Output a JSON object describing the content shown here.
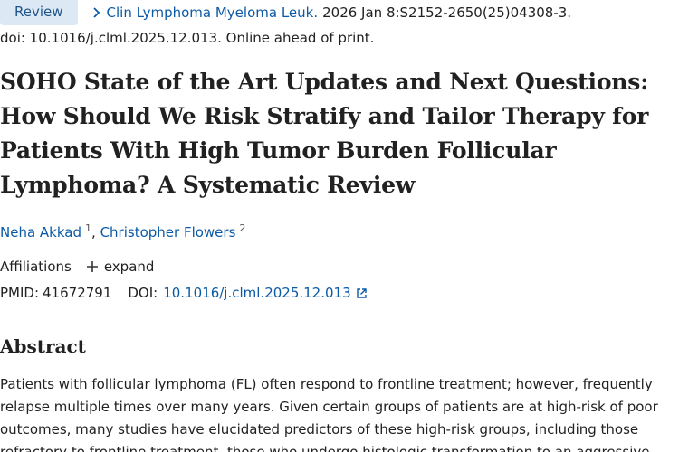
{
  "header": {
    "badge": "Review",
    "journal": "Clin Lymphoma Myeloma Leuk.",
    "citation": "2026 Jan 8:S2152-2650(25)04308-3.",
    "doi_line": "doi: 10.1016/j.clml.2025.12.013. Online ahead of print."
  },
  "article": {
    "title": "SOHO State of the Art Updates and Next Questions: How Should We Risk Stratify and Tailor Therapy for Patients With High Tumor Burden Follicular Lymphoma? A Systematic Review",
    "authors": [
      {
        "name": "Neha Akkad",
        "sup": "1"
      },
      {
        "name": "Christopher Flowers",
        "sup": "2"
      }
    ],
    "author_sep": ",",
    "affiliations_label": "Affiliations",
    "expand_label": "expand",
    "pmid_label": "PMID:",
    "pmid": "41672791",
    "doi_label": "DOI:",
    "doi": "10.1016/j.clml.2025.12.013"
  },
  "abstract": {
    "heading": "Abstract",
    "text": "Patients with follicular lymphoma (FL) often respond to frontline treatment; however, frequently relapse multiple times over many years. Given certain groups of patients are at high-risk of poor outcomes, many studies have elucidated predictors of these high-risk groups, including those refractory to frontline treatment, those who undergo histologic transformation to an aggressive"
  },
  "colors": {
    "link": "#0b5aa6",
    "badge_bg": "#dce9f5",
    "badge_text": "#20558a",
    "text": "#212121"
  },
  "icons": [
    "chevron-right-icon",
    "plus-icon",
    "external-link-icon"
  ]
}
